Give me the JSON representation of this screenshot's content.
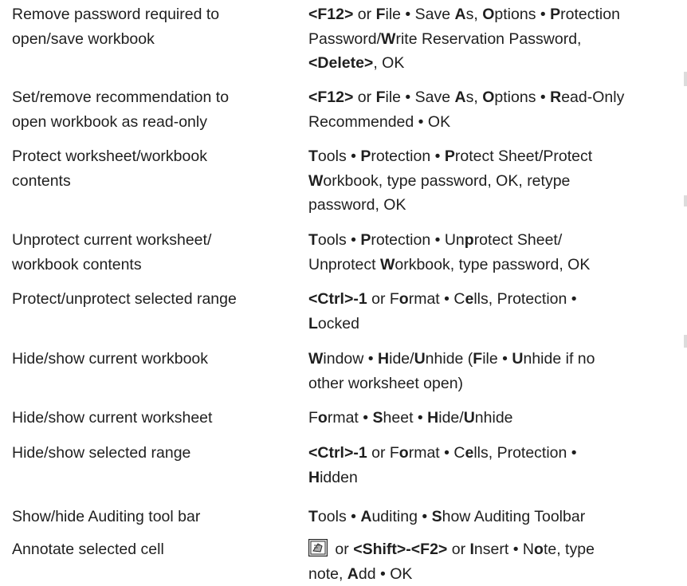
{
  "rows": [
    {
      "task": [
        "Remove password required to",
        "open/save workbook"
      ],
      "keys": [
        [
          {
            "t": "<F12>",
            "b": true
          },
          {
            "t": " or "
          },
          {
            "t": "F",
            "b": true
          },
          {
            "t": "ile • Save "
          },
          {
            "t": "A",
            "b": true
          },
          {
            "t": "s, "
          },
          {
            "t": "O",
            "b": true
          },
          {
            "t": "ptions • "
          },
          {
            "t": "P",
            "b": true
          },
          {
            "t": "rotection"
          }
        ],
        [
          {
            "t": "Password/"
          },
          {
            "t": "W",
            "b": true
          },
          {
            "t": "rite Reservation Password,"
          }
        ],
        [
          {
            "t": "<Delete>",
            "b": true
          },
          {
            "t": ", OK"
          }
        ]
      ]
    },
    {
      "task": [
        "Set/remove recommendation to",
        "open workbook as read-only"
      ],
      "keys": [
        [
          {
            "t": "<F12>",
            "b": true
          },
          {
            "t": " or "
          },
          {
            "t": "F",
            "b": true
          },
          {
            "t": "ile • Save "
          },
          {
            "t": "A",
            "b": true
          },
          {
            "t": "s, "
          },
          {
            "t": "O",
            "b": true
          },
          {
            "t": "ptions • "
          },
          {
            "t": "R",
            "b": true
          },
          {
            "t": "ead-Only"
          }
        ],
        [
          {
            "t": "Recommended • OK"
          }
        ]
      ]
    },
    {
      "task": [
        "Protect worksheet/workbook",
        "contents"
      ],
      "keys": [
        [
          {
            "t": "T",
            "b": true
          },
          {
            "t": "ools • "
          },
          {
            "t": "P",
            "b": true
          },
          {
            "t": "rotection • "
          },
          {
            "t": "P",
            "b": true
          },
          {
            "t": "rotect Sheet/Protect"
          }
        ],
        [
          {
            "t": "W",
            "b": true
          },
          {
            "t": "orkbook, type password, OK, retype"
          }
        ],
        [
          {
            "t": "password, OK"
          }
        ]
      ]
    },
    {
      "task": [
        "Unprotect current worksheet/",
        "workbook contents"
      ],
      "keys": [
        [
          {
            "t": "T",
            "b": true
          },
          {
            "t": "ools • "
          },
          {
            "t": "P",
            "b": true
          },
          {
            "t": "rotection • Un"
          },
          {
            "t": "p",
            "b": true
          },
          {
            "t": "rotect Sheet/"
          }
        ],
        [
          {
            "t": "Unprotect "
          },
          {
            "t": "W",
            "b": true
          },
          {
            "t": "orkbook, type password, OK"
          }
        ]
      ]
    },
    {
      "task": [
        "Protect/unprotect selected range"
      ],
      "keys": [
        [
          {
            "t": "<Ctrl>-1",
            "b": true
          },
          {
            "t": " or F"
          },
          {
            "t": "o",
            "b": true
          },
          {
            "t": "rmat • C"
          },
          {
            "t": "e",
            "b": true
          },
          {
            "t": "lls, Protection •"
          }
        ],
        [
          {
            "t": "L",
            "b": true
          },
          {
            "t": "ocked"
          }
        ]
      ]
    },
    {
      "task": [
        "Hide/show current workbook"
      ],
      "keys": [
        [
          {
            "t": "W",
            "b": true
          },
          {
            "t": "indow • "
          },
          {
            "t": "H",
            "b": true
          },
          {
            "t": "ide/"
          },
          {
            "t": "U",
            "b": true
          },
          {
            "t": "nhide ("
          },
          {
            "t": "F",
            "b": true
          },
          {
            "t": "ile • "
          },
          {
            "t": "U",
            "b": true
          },
          {
            "t": "nhide if no"
          }
        ],
        [
          {
            "t": "other worksheet open)"
          }
        ]
      ]
    },
    {
      "task": [
        "Hide/show current worksheet"
      ],
      "keys": [
        [
          {
            "t": "F"
          },
          {
            "t": "o",
            "b": true
          },
          {
            "t": "rmat • "
          },
          {
            "t": "S",
            "b": true
          },
          {
            "t": "heet • "
          },
          {
            "t": "H",
            "b": true
          },
          {
            "t": "ide/"
          },
          {
            "t": "U",
            "b": true
          },
          {
            "t": "nhide"
          }
        ]
      ]
    },
    {
      "task": [
        "Hide/show selected range"
      ],
      "keys": [
        [
          {
            "t": "<Ctrl>-1",
            "b": true
          },
          {
            "t": " or F"
          },
          {
            "t": "o",
            "b": true
          },
          {
            "t": "rmat • C"
          },
          {
            "t": "e",
            "b": true
          },
          {
            "t": "lls, Protection •"
          }
        ],
        [
          {
            "t": "H",
            "b": true
          },
          {
            "t": "idden"
          }
        ]
      ]
    },
    {
      "task": [
        "Show/hide Auditing tool bar"
      ],
      "keys": [
        [
          {
            "t": "T",
            "b": true
          },
          {
            "t": "ools • "
          },
          {
            "t": "A",
            "b": true
          },
          {
            "t": "uditing • "
          },
          {
            "t": "S",
            "b": true
          },
          {
            "t": "how Auditing Toolbar"
          }
        ]
      ]
    },
    {
      "task": [
        "Annotate selected cell"
      ],
      "icon": "note-toolbar-icon",
      "keys": [
        [
          {
            "t": " or "
          },
          {
            "t": "<Shift>-<F2>",
            "b": true
          },
          {
            "t": " or "
          },
          {
            "t": "I",
            "b": true
          },
          {
            "t": "nsert • N"
          },
          {
            "t": "o",
            "b": true
          },
          {
            "t": "te, type"
          }
        ],
        [
          {
            "t": "note, "
          },
          {
            "t": "A",
            "b": true
          },
          {
            "t": "dd • OK"
          }
        ]
      ]
    }
  ]
}
